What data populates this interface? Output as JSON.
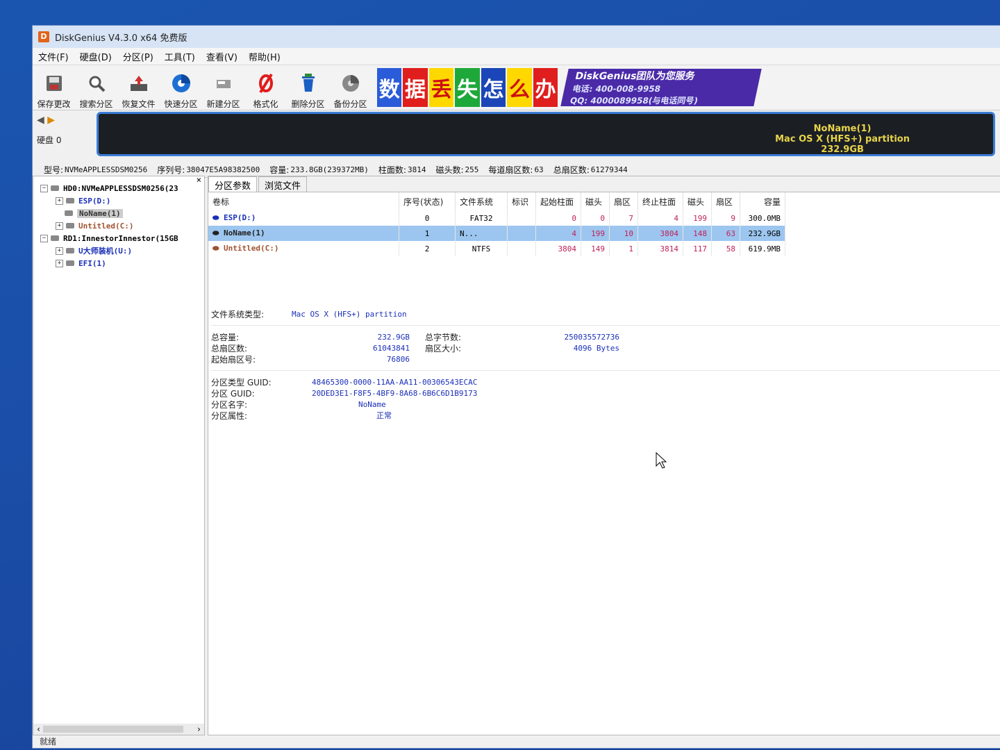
{
  "window": {
    "title": "DiskGenius V4.3.0 x64 免费版"
  },
  "menu": [
    "文件(F)",
    "硬盘(D)",
    "分区(P)",
    "工具(T)",
    "查看(V)",
    "帮助(H)"
  ],
  "toolbar": [
    {
      "label": "保存更改",
      "icon": "save-icon"
    },
    {
      "label": "搜索分区",
      "icon": "search-icon"
    },
    {
      "label": "恢复文件",
      "icon": "recover-icon"
    },
    {
      "label": "快速分区",
      "icon": "quick-partition-icon"
    },
    {
      "label": "新建分区",
      "icon": "new-partition-icon"
    },
    {
      "label": "格式化",
      "icon": "format-icon"
    },
    {
      "label": "删除分区",
      "icon": "delete-icon"
    },
    {
      "label": "备份分区",
      "icon": "backup-icon"
    }
  ],
  "banner": {
    "chars": [
      "数",
      "据",
      "丢",
      "失",
      "怎",
      "么",
      "办"
    ],
    "colors": [
      "#2a5bd8",
      "#e01e1e",
      "#ffd800",
      "#1fa83a",
      "#1b46b8",
      "#e01e1e",
      "#e01e1e"
    ],
    "ad_text": "DiskGenius团队为您服务",
    "phone": "电话: 400-008-9958",
    "qq": "QQ: 4000089958(与电话同号)"
  },
  "disk_panel": {
    "disk_label": "硬盘 0",
    "partition_name": "NoName(1)",
    "partition_fs": "Mac OS X (HFS+) partition",
    "partition_size": "232.9GB"
  },
  "disk_info": {
    "model_label": "型号:",
    "model": "NVMeAPPLESSDSM0256",
    "serial_label": "序列号:",
    "serial": "38047E5A98382500",
    "capacity_label": "容量:",
    "capacity": "233.8GB(239372MB)",
    "cylinders_label": "柱面数:",
    "cylinders": "3814",
    "heads_label": "磁头数:",
    "heads": "255",
    "spt_label": "每道扇区数:",
    "spt": "63",
    "total_sectors_label": "总扇区数:",
    "total_sectors": "61279344"
  },
  "tree": {
    "hd0": "HD0:NVMeAPPLESSDSM0256(23",
    "hd0_parts": [
      "ESP(D:)",
      "NoName(1)",
      "Untitled(C:)"
    ],
    "rd1": "RD1:InnestorInnestor(15GB",
    "rd1_parts": [
      "U大师装机(U:)",
      "EFI(1)"
    ]
  },
  "tabs": [
    "分区参数",
    "浏览文件"
  ],
  "table": {
    "headers": [
      "卷标",
      "序号(状态)",
      "文件系统",
      "标识",
      "起始柱面",
      "磁头",
      "扇区",
      "终止柱面",
      "磁头",
      "扇区",
      "容量"
    ],
    "rows": [
      [
        "ESP(D:)",
        "0",
        "FAT32",
        "",
        "0",
        "0",
        "7",
        "4",
        "199",
        "9",
        "300.0MB"
      ],
      [
        "NoName(1)",
        "1",
        "N...",
        "",
        "4",
        "199",
        "10",
        "3804",
        "148",
        "63",
        "232.9GB"
      ],
      [
        "Untitled(C:)",
        "2",
        "NTFS",
        "",
        "3804",
        "149",
        "1",
        "3814",
        "117",
        "58",
        "619.9MB"
      ]
    ]
  },
  "details": {
    "fs_type_label": "文件系统类型:",
    "fs_type": "Mac OS X (HFS+) partition",
    "total_cap_label": "总容量:",
    "total_cap": "232.9GB",
    "total_bytes_label": "总字节数:",
    "total_bytes": "250035572736",
    "total_sectors_label": "总扇区数:",
    "total_sectors": "61043841",
    "sector_size_label": "扇区大小:",
    "sector_size": "4096 Bytes",
    "start_sector_label": "起始扇区号:",
    "start_sector": "76806",
    "type_guid_label": "分区类型 GUID:",
    "type_guid": "48465300-0000-11AA-AA11-00306543ECAC",
    "guid_label": "分区 GUID:",
    "guid": "20DED3E1-F8F5-4BF9-8A68-6B6C6D1B9173",
    "name_label": "分区名字:",
    "name": "NoName",
    "attr_label": "分区属性:",
    "attr": "正常"
  },
  "status": "就绪"
}
